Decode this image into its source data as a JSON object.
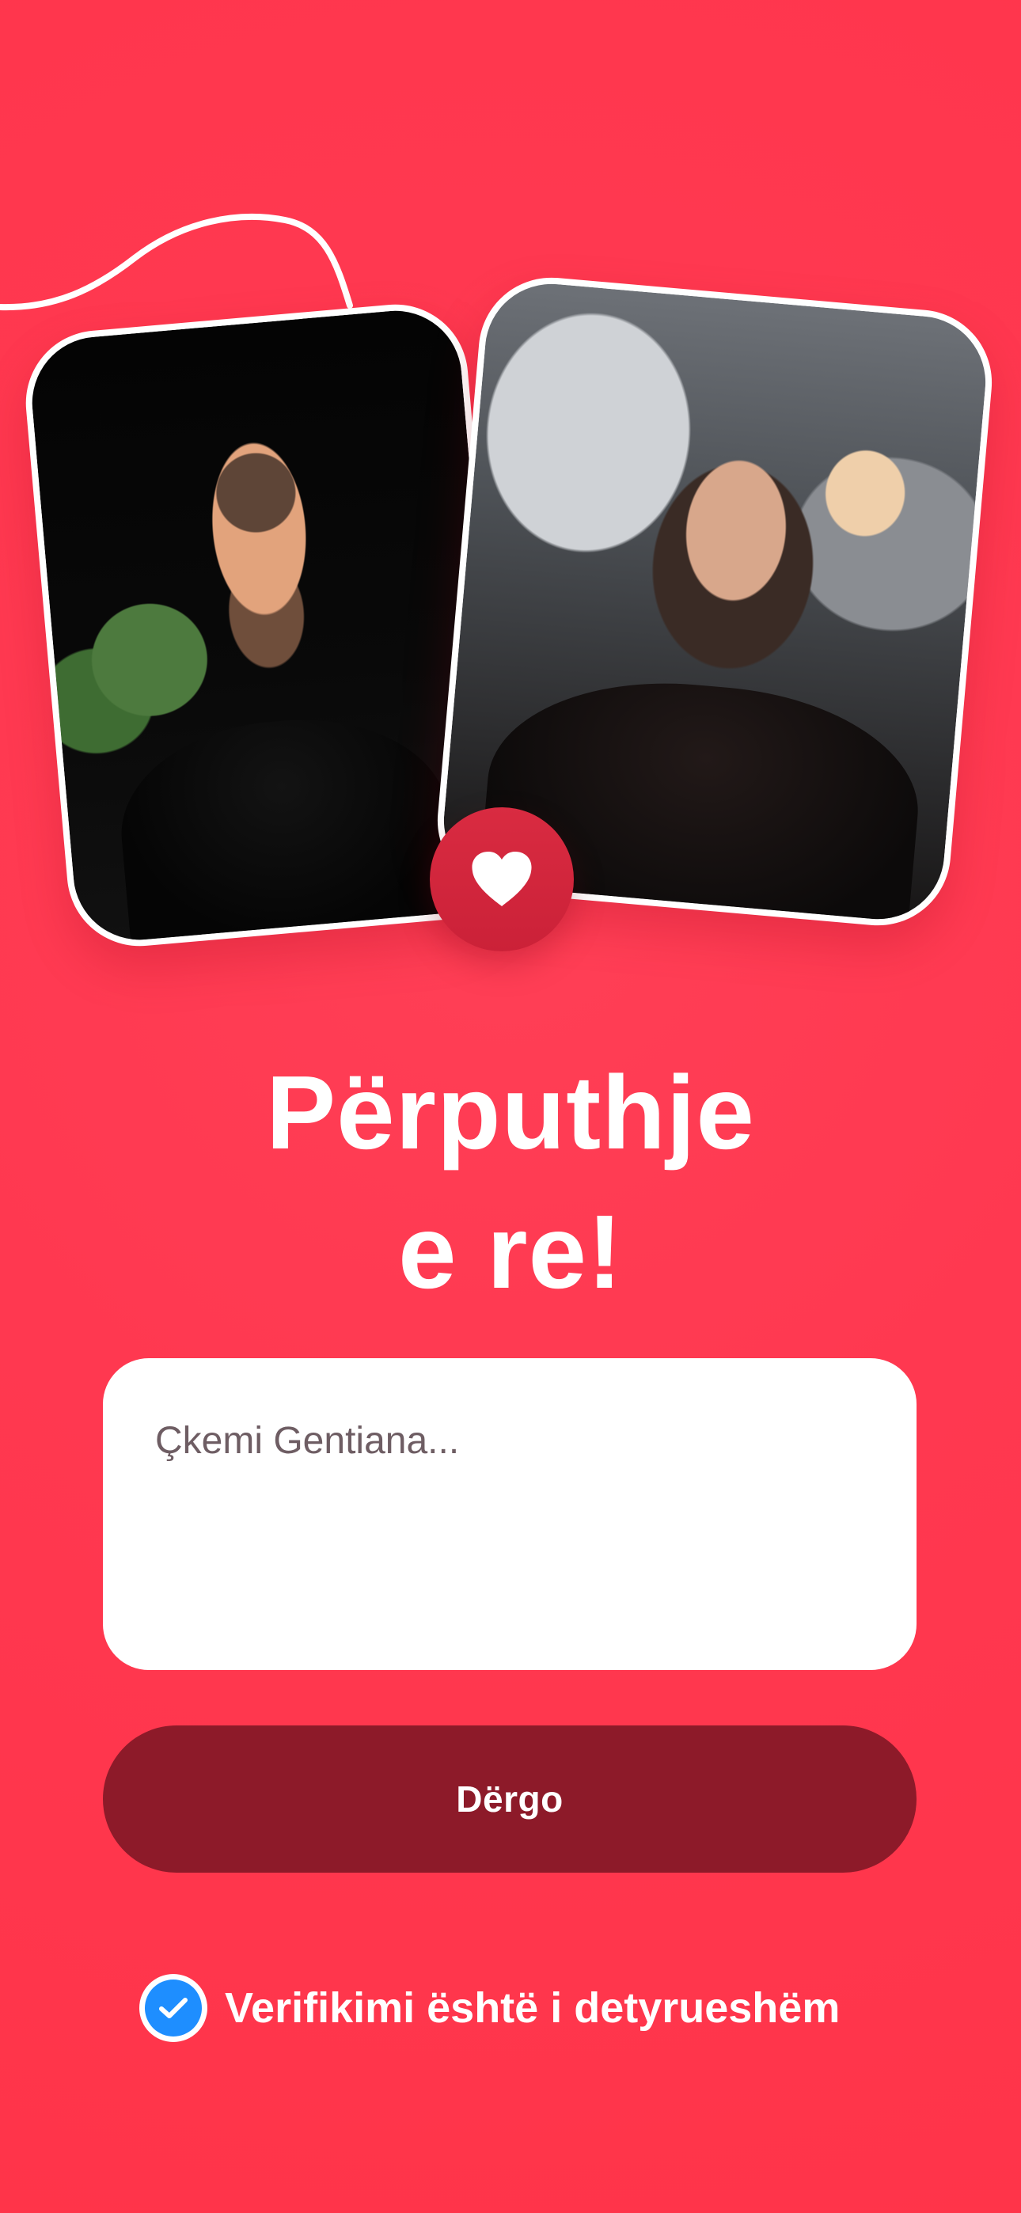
{
  "theme": {
    "background_color": "#ff3a50",
    "heart_badge_color": "#d92b41",
    "button_color": "#8d1a29",
    "verification_icon_color": "#1e8eff"
  },
  "match": {
    "title_line_1": "Përputhje",
    "title_line_2": "e re!"
  },
  "message": {
    "placeholder": "Çkemi Gentiana..."
  },
  "actions": {
    "send_label": "Dërgo"
  },
  "verification": {
    "text": "Verifikimi është i detyrueshëm",
    "icon": "verified-check-icon"
  },
  "icons": {
    "match_badge": "heart-icon",
    "decoration": "curved-line"
  }
}
